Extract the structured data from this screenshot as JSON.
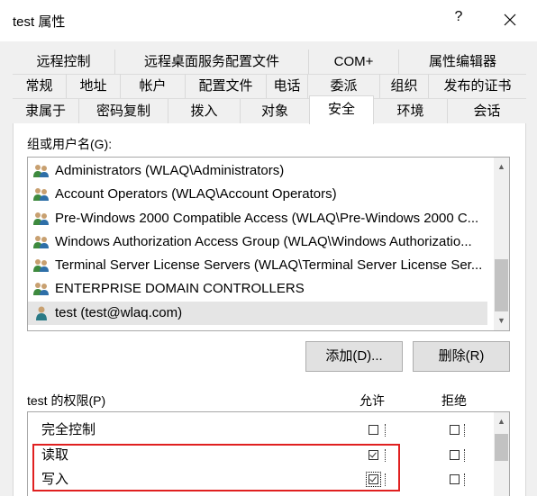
{
  "window": {
    "title": "test 属性",
    "help_glyph": "?",
    "close_icon": "close-icon"
  },
  "tabs": {
    "row1": [
      "远程控制",
      "远程桌面服务配置文件",
      "COM+",
      "属性编辑器"
    ],
    "row2": [
      "常规",
      "地址",
      "帐户",
      "配置文件",
      "电话",
      "委派",
      "组织",
      "发布的证书"
    ],
    "row3": [
      "隶属于",
      "密码复制",
      "拨入",
      "对象",
      "安全",
      "环境",
      "会话"
    ],
    "active": "安全"
  },
  "security": {
    "group_label": "组或用户名(G):",
    "principals": [
      {
        "name": "Administrators (WLAQ\\Administrators)",
        "icon": "group-icon"
      },
      {
        "name": "Account Operators (WLAQ\\Account Operators)",
        "icon": "group-icon"
      },
      {
        "name": "Pre-Windows 2000 Compatible Access (WLAQ\\Pre-Windows 2000 C...",
        "icon": "group-icon"
      },
      {
        "name": "Windows Authorization Access Group (WLAQ\\Windows Authorizatio...",
        "icon": "group-icon"
      },
      {
        "name": "Terminal Server License Servers (WLAQ\\Terminal Server License Ser...",
        "icon": "group-icon"
      },
      {
        "name": "ENTERPRISE DOMAIN CONTROLLERS",
        "icon": "group-icon"
      },
      {
        "name": "test (test@wlaq.com)",
        "icon": "user-icon",
        "selected": true
      }
    ],
    "add_button": "添加(D)...",
    "remove_button": "删除(R)",
    "perm_label": "test 的权限(P)",
    "allow_header": "允许",
    "deny_header": "拒绝",
    "permissions": [
      {
        "name": "完全控制",
        "allow": false,
        "deny": false
      },
      {
        "name": "读取",
        "allow": true,
        "deny": false
      },
      {
        "name": "写入",
        "allow": true,
        "deny": false
      }
    ]
  },
  "colors": {
    "highlight_box": "#e02020",
    "selected_row": "#e5e5e5",
    "group_icon_green": "#3e8a3e",
    "user_icon_teal": "#2a7a86"
  }
}
